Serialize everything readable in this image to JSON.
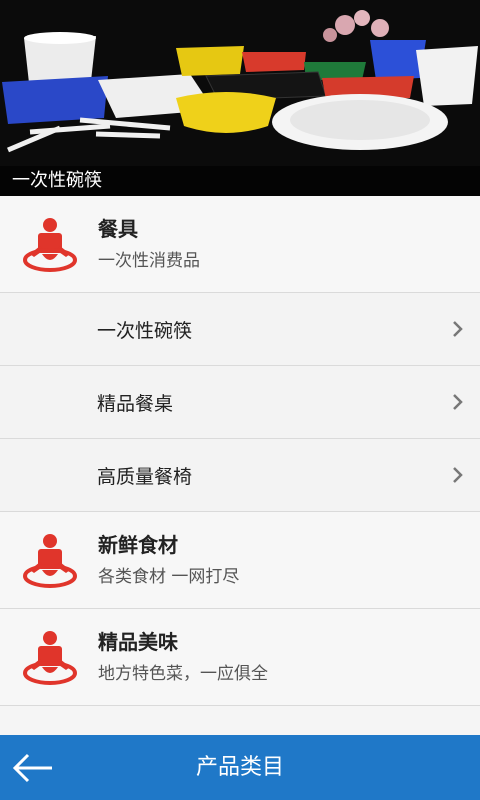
{
  "banner": {
    "caption": "一次性碗筷",
    "image_alt": "disposable-tableware-photo"
  },
  "categories": [
    {
      "title": "餐具",
      "subtitle": "一次性消费品",
      "icon": "baby-icon",
      "children": [
        {
          "label": "一次性碗筷",
          "icon": "chevron-right-icon"
        },
        {
          "label": "精品餐桌",
          "icon": "chevron-right-icon"
        },
        {
          "label": "高质量餐椅",
          "icon": "chevron-right-icon"
        }
      ]
    },
    {
      "title": "新鲜食材",
      "subtitle": "各类食材 一网打尽",
      "icon": "baby-icon",
      "children": []
    },
    {
      "title": "精品美味",
      "subtitle": "地方特色菜，一应俱全",
      "icon": "baby-icon",
      "children": []
    }
  ],
  "bottom_bar": {
    "title": "产品类目",
    "back_icon": "arrow-left-icon"
  },
  "colors": {
    "accent": "#1f78c8",
    "icon_red": "#e0352b"
  }
}
